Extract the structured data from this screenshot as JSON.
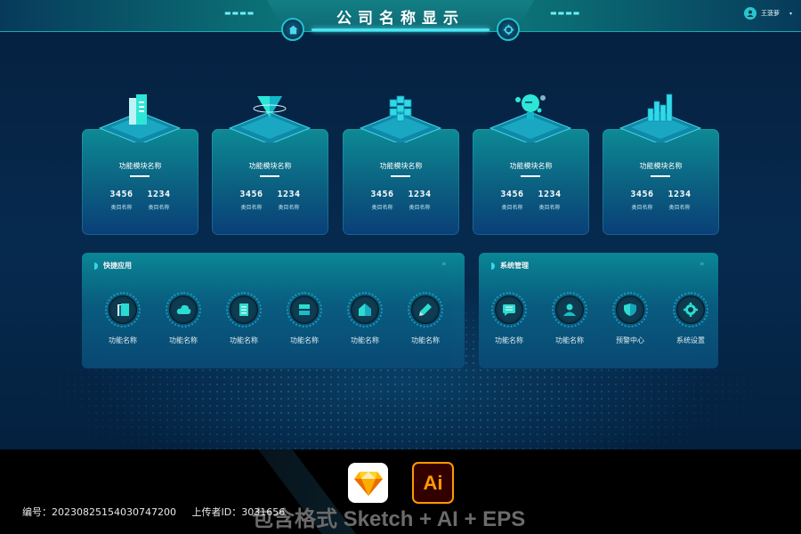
{
  "header": {
    "title": "公司名称显示",
    "left_dashes": "▬▬▬▬",
    "right_dashes": "▬▬▬▬",
    "home_icon": "home-icon",
    "settings_icon": "gear-icon"
  },
  "user": {
    "name": "王菠萝",
    "avatar_icon": "user-icon",
    "caret": "▾"
  },
  "modules": [
    {
      "icon": "building-icon",
      "title": "功能模块名称",
      "stats": [
        {
          "value": "3456",
          "label": "类目名称"
        },
        {
          "value": "1234",
          "label": "类目名称"
        }
      ]
    },
    {
      "icon": "funnel-icon",
      "title": "功能模块名称",
      "stats": [
        {
          "value": "3456",
          "label": "类目名称"
        },
        {
          "value": "1234",
          "label": "类目名称"
        }
      ]
    },
    {
      "icon": "cubes-icon",
      "title": "功能模块名称",
      "stats": [
        {
          "value": "3456",
          "label": "类目名称"
        },
        {
          "value": "1234",
          "label": "类目名称"
        }
      ]
    },
    {
      "icon": "robot-icon",
      "title": "功能模块名称",
      "stats": [
        {
          "value": "3456",
          "label": "类目名称"
        },
        {
          "value": "1234",
          "label": "类目名称"
        }
      ]
    },
    {
      "icon": "bar-chart-icon",
      "title": "功能模块名称",
      "stats": [
        {
          "value": "3456",
          "label": "类目名称"
        },
        {
          "value": "1234",
          "label": "类目名称"
        }
      ]
    }
  ],
  "quick_apps": {
    "title": "快捷应用",
    "more": "»",
    "items": [
      {
        "icon": "book-icon",
        "label": "功能名称"
      },
      {
        "icon": "cloud-icon",
        "label": "功能名称"
      },
      {
        "icon": "document-icon",
        "label": "功能名称"
      },
      {
        "icon": "layers-icon",
        "label": "功能名称"
      },
      {
        "icon": "home-icon",
        "label": "功能名称"
      },
      {
        "icon": "pencil-icon",
        "label": "功能名称"
      }
    ]
  },
  "system": {
    "title": "系统管理",
    "more": "»",
    "items": [
      {
        "icon": "message-icon",
        "label": "功能名称"
      },
      {
        "icon": "user-icon",
        "label": "功能名称"
      },
      {
        "icon": "shield-icon",
        "label": "预警中心"
      },
      {
        "icon": "gear-icon",
        "label": "系统设置"
      }
    ]
  },
  "footer": {
    "formats": "包含格式 Sketch + AI + EPS",
    "ai_label": "Ai",
    "id_label": "编号：20230825154030747200",
    "uploader_label": "上传者ID：3031656"
  }
}
